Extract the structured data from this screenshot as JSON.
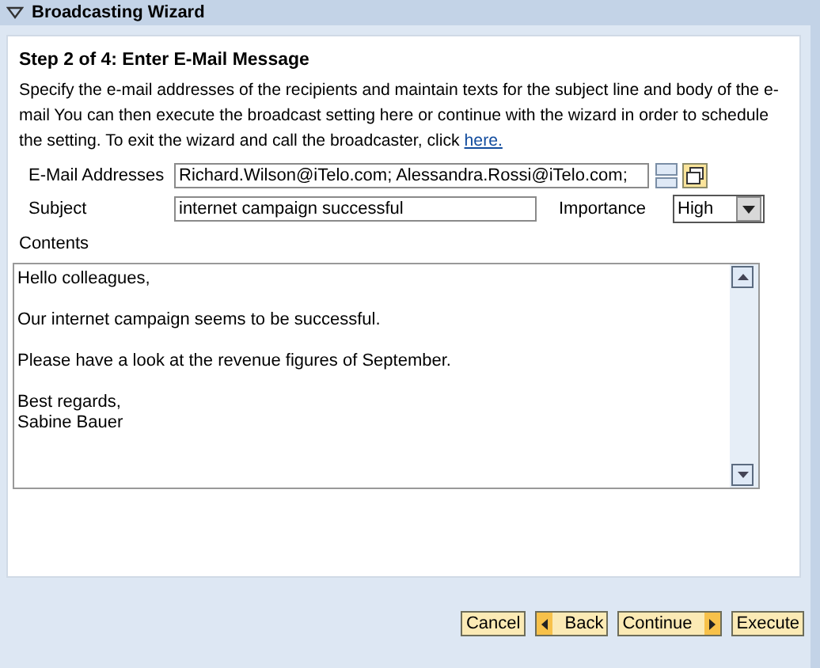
{
  "window": {
    "title": "Broadcasting Wizard",
    "expanded": true
  },
  "step": {
    "title": "Step 2 of 4: Enter E-Mail Message",
    "description": "Specify the e-mail addresses of the recipients and maintain texts for the subject line and body of the e-mail You can then execute the broadcast setting here or continue with the wizard in order to schedule the setting. To exit the wizard and call the broadcaster, click",
    "link": "here."
  },
  "form": {
    "email_label": "E-Mail Addresses",
    "email_value": "Richard.Wilson@iTelo.com; Alessandra.Rossi@iTelo.com;",
    "subject_label": "Subject",
    "subject_value": "internet campaign successful",
    "importance_label": "Importance",
    "importance_value": "High",
    "contents_label": "Contents",
    "contents": [
      "Hello colleagues,",
      "Our internet campaign seems to be successful.",
      "Please have a look at the revenue figures of September.",
      "Best regards,\nSabine Bauer"
    ]
  },
  "buttons": [
    {
      "label": "Cancel",
      "kind": "plain"
    },
    {
      "label": "Back",
      "kind": "back"
    },
    {
      "label": "Continue",
      "kind": "next"
    },
    {
      "label": "Execute",
      "kind": "plain"
    }
  ]
}
